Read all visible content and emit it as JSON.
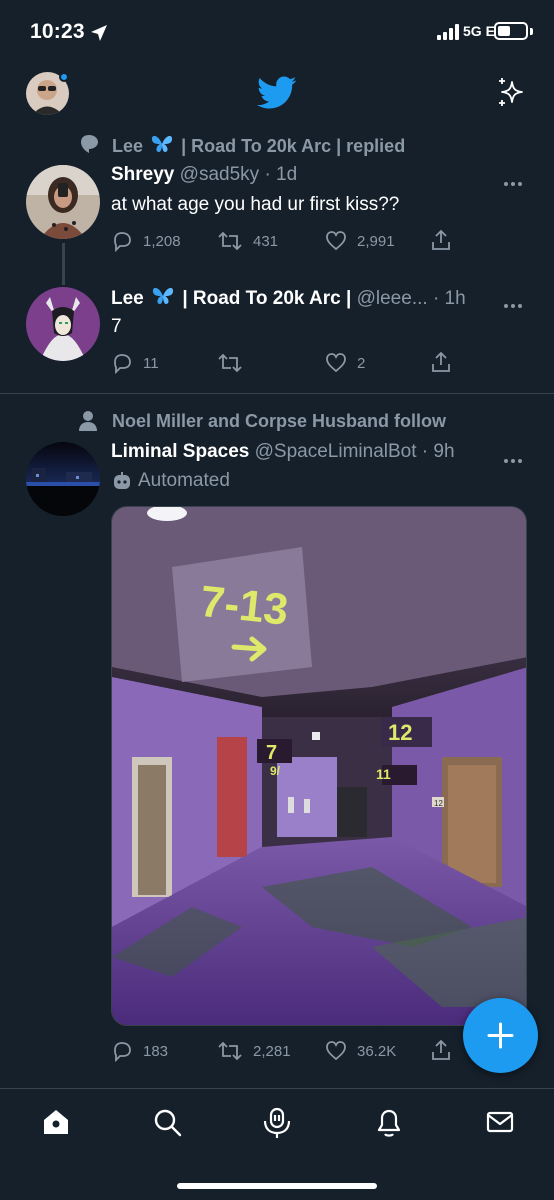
{
  "status_bar": {
    "time": "10:23",
    "network": "5G E"
  },
  "tweets": [
    {
      "social_context": {
        "prefix": "Lee",
        "suffix": "| Road To 20k Arc | replied"
      },
      "name": "Shreyy",
      "handle": "@sad5ky",
      "time": "· 1d",
      "text": "at what age you had ur first kiss??",
      "replies": "1,208",
      "retweets": "431",
      "likes": "2,991"
    },
    {
      "name_prefix": "Lee",
      "name_suffix": "| Road To 20k Arc |",
      "handle": "@leee...",
      "time": "· 1h",
      "text": "7",
      "replies": "11",
      "retweets": "",
      "likes": "2"
    },
    {
      "social_context": {
        "text": "Noel Miller and Corpse Husband follow"
      },
      "name": "Liminal Spaces",
      "handle": "@SpaceLiminalBot",
      "time": "· 9h",
      "automated_label": "Automated",
      "media_signs": {
        "main": "7-13",
        "sign_12": "12",
        "sign_7": "7",
        "sign_9": "9/",
        "sign_11": "11",
        "door_number": "12"
      },
      "replies": "183",
      "retweets": "2,281",
      "likes": "36.2K"
    }
  ],
  "icons": {
    "header": [
      "profile-avatar",
      "twitter-bird-icon",
      "sparkle-icon"
    ],
    "nav": [
      "home-icon",
      "search-icon",
      "spaces-icon",
      "notifications-icon",
      "messages-icon"
    ],
    "fab": "plus-icon"
  },
  "colors": {
    "background": "#15202b",
    "accent": "#1d9bf0",
    "secondary_text": "#8b98a5",
    "divider": "#38444d"
  }
}
